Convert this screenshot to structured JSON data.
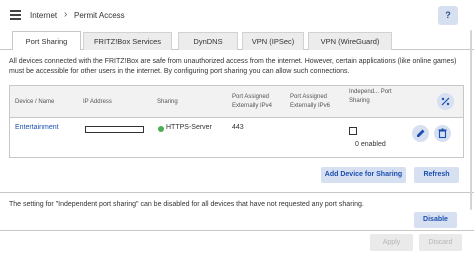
{
  "header": {
    "breadcrumb": [
      "Internet",
      "Permit Access"
    ],
    "separator": "›",
    "help_label": "?"
  },
  "tabs": [
    {
      "label": "Port Sharing",
      "active": true
    },
    {
      "label": "FRITZ!Box Services",
      "active": false
    },
    {
      "label": "DynDNS",
      "active": false
    },
    {
      "label": "VPN (IPSec)",
      "active": false
    },
    {
      "label": "VPN (WireGuard)",
      "active": false
    }
  ],
  "description": "All devices connected with the FRITZ!Box are safe from unauthorized access from the internet. However, certain applications (like online games) must be accessible for other users in the internet. By configuring port sharing you can allow such connections.",
  "table": {
    "columns": {
      "device": "Device / Name",
      "ip": "IP Address",
      "sharing": "Sharing",
      "ipv4": "Port Assigned Externally IPv4",
      "ipv6": "Port Assigned Externally IPv6",
      "independent": "Independ... Port Sharing"
    },
    "rows": [
      {
        "device": "Entertainment",
        "ip": "",
        "status_color": "#4caf50",
        "sharing": "HTTPS-Server",
        "ipv4": "443",
        "ipv6": "",
        "independent_checked": false,
        "enabled_count": "0 enabled"
      }
    ]
  },
  "actions": {
    "add_device": "Add Device for Sharing",
    "refresh": "Refresh"
  },
  "note": "The setting for \"Independent port sharing\" can be disabled for all devices that have not requested any port sharing.",
  "disable_label": "Disable",
  "apply_label": "Apply",
  "discard_label": "Discard",
  "colors": {
    "accent": "#1b4fb1",
    "button_bg": "#d6e0f1",
    "status_green": "#4caf50"
  }
}
